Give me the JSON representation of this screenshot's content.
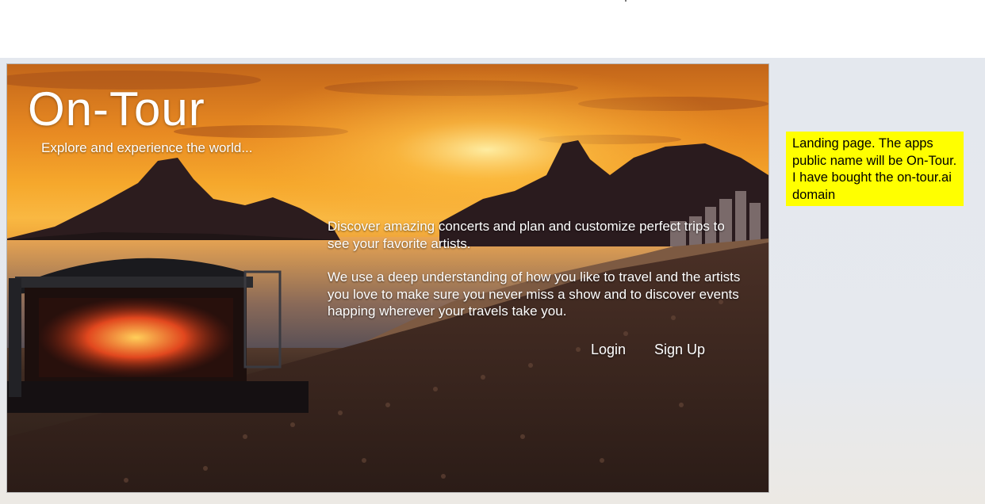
{
  "hero": {
    "brand_title": "On-Tour",
    "tagline": "Explore and experience the world...",
    "intro_paragraph_1": "Discover amazing concerts and plan and customize perfect trips to see your favorite artists.",
    "intro_paragraph_2": "We use a deep understanding of how you like to travel and the artists you love to make sure you never miss a show and to discover events happing wherever your travels take you.",
    "login_label": "Login",
    "signup_label": "Sign Up"
  },
  "note": {
    "text": "Landing page.  The apps public name will be On-Tour.  I have bought the on-tour.ai domain",
    "color": "#ffff00"
  }
}
